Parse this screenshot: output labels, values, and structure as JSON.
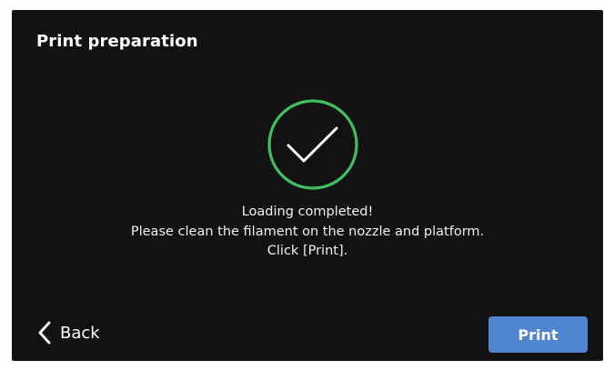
{
  "header": {
    "title": "Print preparation"
  },
  "status": {
    "icon": "check-circle-icon",
    "accent_color": "#3fbf5f"
  },
  "message": {
    "line1": "Loading completed!",
    "line2": "Please clean the filament on the nozzle and platform.",
    "line3": "Click [Print]."
  },
  "footer": {
    "back_icon": "chevron-left-icon",
    "back_label": "Back",
    "print_label": "Print",
    "print_color": "#4f86cf"
  }
}
